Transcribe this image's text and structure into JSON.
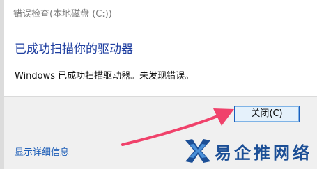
{
  "window": {
    "title": "错误检查(本地磁盘 (C:))"
  },
  "dialog": {
    "heading": "已成功扫描你的驱动器",
    "message": "Windows 已成功扫描驱动器。未发现错误。",
    "close_button_label": "关闭(C)",
    "details_link": "显示详细信息"
  },
  "annotation": {
    "arrow_color": "#f0426b",
    "arrow_icon": "pointer-arrow-icon"
  },
  "watermark": {
    "text": "易企推网络",
    "logo_icon": "watermark-logo-icon",
    "color": "#1c4f96"
  },
  "colors": {
    "heading": "#1e3ea0",
    "link": "#1f5fb8",
    "button_border": "#1b5fbd",
    "button_fill": "#e5f1fb"
  }
}
